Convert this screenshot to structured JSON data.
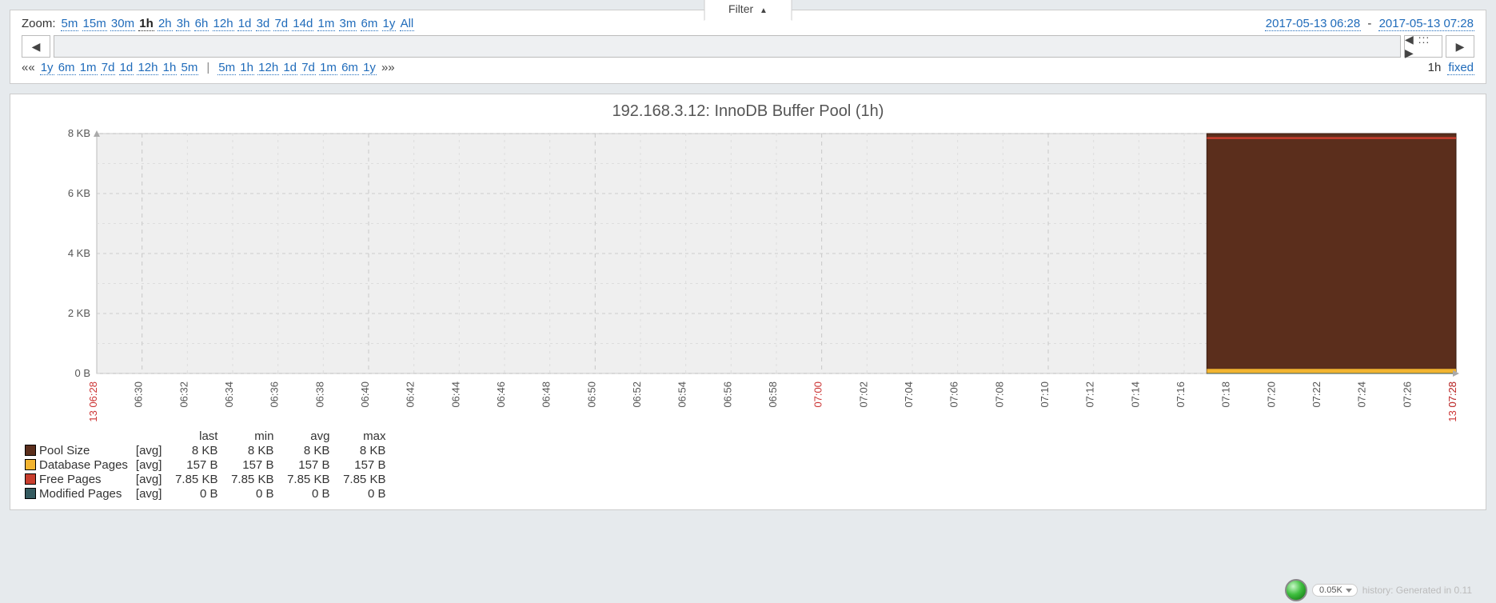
{
  "filter_tab": {
    "label": "Filter"
  },
  "zoom": {
    "label": "Zoom:",
    "options": [
      "5m",
      "15m",
      "30m",
      "1h",
      "2h",
      "3h",
      "6h",
      "12h",
      "1d",
      "3d",
      "7d",
      "14d",
      "1m",
      "3m",
      "6m",
      "1y",
      "All"
    ],
    "selected": "1h"
  },
  "daterange": {
    "from": "2017-05-13 06:28",
    "to": "2017-05-13 07:28",
    "sep": "-"
  },
  "slider": {
    "prev_glyph": "◀",
    "next_glyph": "▶",
    "dots": "◀ ::: ▶"
  },
  "nav": {
    "back_dbl": "««",
    "fwd_dbl": "»»",
    "left_steps": [
      "1y",
      "6m",
      "1m",
      "7d",
      "1d",
      "12h",
      "1h",
      "5m"
    ],
    "right_steps": [
      "5m",
      "1h",
      "12h",
      "1d",
      "7d",
      "1m",
      "6m",
      "1y"
    ],
    "current": "1h",
    "mode": "fixed"
  },
  "chart_title": "192.168.3.12: InnoDB Buffer Pool (1h)",
  "status": {
    "value": "0.05K",
    "footer": "history: Generated in 0.11"
  },
  "chart_data": {
    "type": "area",
    "title": "192.168.3.12: InnoDB Buffer Pool (1h)",
    "xlabel": "",
    "ylabel": "",
    "y_ticks": [
      "0 B",
      "2 KB",
      "4 KB",
      "6 KB",
      "8 KB"
    ],
    "ylim_bytes": [
      0,
      8192
    ],
    "x_time_range": [
      "05-13 06:28",
      "05-13 07:28"
    ],
    "x_ticks": [
      "06:30",
      "06:32",
      "06:34",
      "06:36",
      "06:38",
      "06:40",
      "06:42",
      "06:44",
      "06:46",
      "06:48",
      "06:50",
      "06:52",
      "06:54",
      "06:56",
      "06:58",
      "07:00",
      "07:02",
      "07:04",
      "07:06",
      "07:08",
      "07:10",
      "07:12",
      "07:14",
      "07:16",
      "07:18",
      "07:20",
      "07:22",
      "07:24",
      "07:26",
      "07:28"
    ],
    "x_special_ticks": [
      {
        "label": "05-13 06:28",
        "pos": "start",
        "color": "#cc3333"
      },
      {
        "label": "07:00",
        "color": "#cc3333"
      },
      {
        "label": "05-13 07:28",
        "pos": "end",
        "color": "#cc3333"
      }
    ],
    "data_start_time": "07:17",
    "series": [
      {
        "name": "Pool Size",
        "agg": "[avg]",
        "color": "#5b2e1c",
        "last": "8 KB",
        "min": "8 KB",
        "avg": "8 KB",
        "max": "8 KB",
        "value_bytes": 8192,
        "notes": "constant from 07:17 to 07:28; no data before"
      },
      {
        "name": "Free Pages",
        "agg": "[avg]",
        "color": "#c83e2e",
        "last": "7.85 KB",
        "min": "7.85 KB",
        "avg": "7.85 KB",
        "max": "7.85 KB",
        "value_bytes": 8038,
        "notes": "constant, thin line near top under Pool Size"
      },
      {
        "name": "Database Pages",
        "agg": "[avg]",
        "color": "#f2b430",
        "last": "157 B",
        "min": "157 B",
        "avg": "157 B",
        "max": "157 B",
        "value_bytes": 157,
        "notes": "constant, thin band at bottom"
      },
      {
        "name": "Modified Pages",
        "agg": "[avg]",
        "color": "#345a5f",
        "last": "0 B",
        "min": "0 B",
        "avg": "0 B",
        "max": "0 B",
        "value_bytes": 0,
        "notes": "zero"
      }
    ],
    "legend_columns": [
      "",
      "",
      "last",
      "min",
      "avg",
      "max"
    ]
  }
}
